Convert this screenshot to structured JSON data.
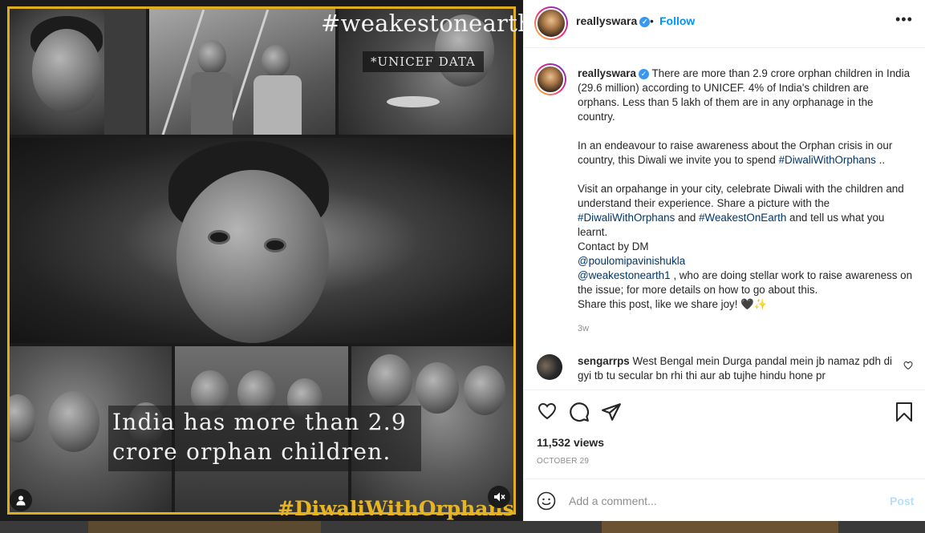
{
  "media": {
    "hashtag_top": "#weakestonearth",
    "source_badge": "*UNICEF DATA",
    "caption": "India has more than 2.9 crore orphan children.",
    "hashtag_bottom": "#DiwaliWithOrphans"
  },
  "header": {
    "username": "reallyswara",
    "separator": "•",
    "follow_label": "Follow",
    "more_label": "•••"
  },
  "post": {
    "username": "reallyswara",
    "text_1": "There are more than 2.9 crore orphan children in India (29.6 million) according to UNICEF. 4% of India's children are orphans. Less than 5 lakh of them are in any orphanage in the country.",
    "text_2a": "In an endeavour to raise awareness about the Orphan crisis in our country, this Diwali we invite you to spend ",
    "hashtag_diwali": "#DiwaliWithOrphans",
    "text_2b": " ..",
    "text_3a": "Visit an orpahange in your city, celebrate Diwali with the children and understand their experience. Share a picture with the ",
    "hashtag_diwali_2": "#DiwaliWithOrphans",
    "text_3b": " and ",
    "hashtag_weakest": "#WeakestOnEarth",
    "text_3c": " and tell us what you learnt.",
    "contact": "Contact by DM",
    "mention_1": "@poulomipavinishukla",
    "mention_2": "@weakestonearth1",
    "text_4": " , who are doing stellar work to raise awareness on the issue; for more details on how to go about this.",
    "text_5": "Share this post, like we share joy! 🖤✨",
    "time": "3w"
  },
  "comment": {
    "username": "sengarrps",
    "text": "West Bengal mein Durga pandal mein jb namaz pdh di gyi tb tu secular bn rhi thi aur ab tujhe hindu hone pr"
  },
  "stats": {
    "views": "11,532 views",
    "date": "OCTOBER 29"
  },
  "add_comment": {
    "placeholder": "Add a comment...",
    "post_label": "Post"
  },
  "colors": {
    "accent": "#0095f6",
    "link": "#00376b",
    "frame_gold": "#e0ad1f",
    "post_disabled": "#b2dffc"
  }
}
